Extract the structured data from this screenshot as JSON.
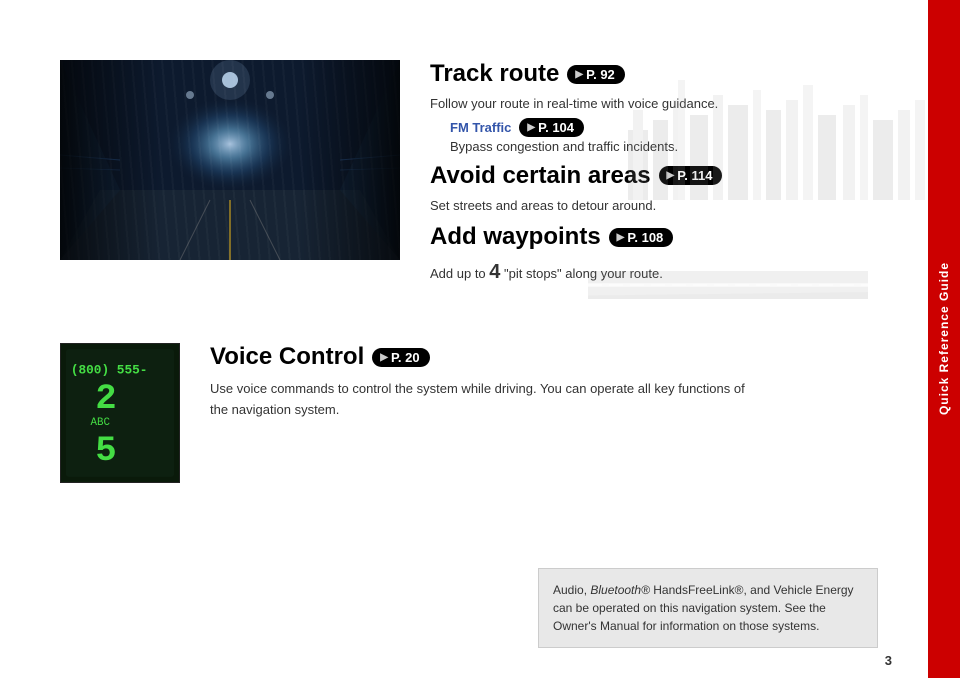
{
  "sidebar": {
    "label": "Quick Reference Guide",
    "color": "#cc0000"
  },
  "top_section": {
    "track_route": {
      "heading": "Track route",
      "page_ref": "P. 92",
      "description": "Follow your route in real-time with voice guidance.",
      "fm_traffic_label": "FM Traffic",
      "fm_traffic_ref": "P. 104",
      "bypass_text": "Bypass congestion and traffic incidents."
    },
    "avoid_areas": {
      "heading": "Avoid certain areas",
      "page_ref": "P. 114",
      "description": "Set streets and areas to detour around."
    },
    "add_waypoints": {
      "heading": "Add waypoints",
      "page_ref": "P. 108",
      "number": "4",
      "description_pre": "Add up to ",
      "description_post": " \"pit stops\" along your route."
    }
  },
  "voice_control": {
    "heading": "Voice Control",
    "page_ref": "P. 20",
    "phone_number": "(800) 555-",
    "phone_digit_2": "2",
    "phone_abc": "ABC",
    "phone_digit_5": "5",
    "description": "Use voice commands to control the system while driving. You can operate all key functions of the navigation system."
  },
  "bottom_note": {
    "text_1": "Audio, ",
    "bluetooth": "Bluetooth®",
    "text_2": " HandsFreeLink®, and Vehicle Energy can be operated on this navigation system. See the Owner's Manual for information on those systems."
  },
  "page_number": "3"
}
